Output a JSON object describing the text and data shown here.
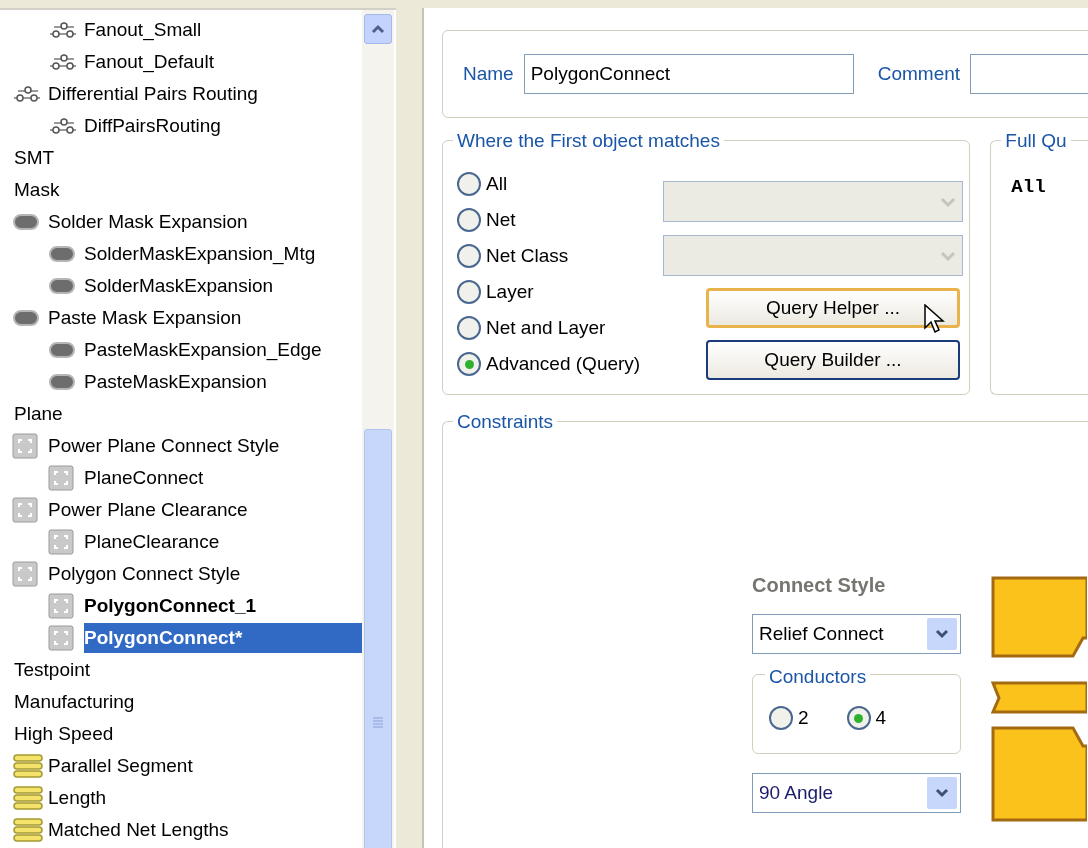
{
  "tree": [
    {
      "children": [
        {
          "children": [
            {
              "label": "Fanout_Small",
              "kind": "routing",
              "bold": false,
              "selected": false
            },
            {
              "label": "Fanout_Default",
              "kind": "routing",
              "bold": false,
              "selected": false
            }
          ]
        },
        {
          "label": "Differential Pairs Routing",
          "kind": "routing",
          "bold": false,
          "selected": false,
          "children": [
            {
              "label": "DiffPairsRouting",
              "kind": "routing",
              "bold": false,
              "selected": false
            }
          ]
        }
      ]
    },
    {
      "label": "SMT",
      "bold": false,
      "selected": false
    },
    {
      "label": "Mask",
      "bold": false,
      "selected": false,
      "children": [
        {
          "label": "Solder Mask Expansion",
          "kind": "mask",
          "bold": false,
          "selected": false,
          "children": [
            {
              "label": "SolderMaskExpansion_Mtg",
              "kind": "mask",
              "bold": false,
              "selected": false
            },
            {
              "label": "SolderMaskExpansion",
              "kind": "mask",
              "bold": false,
              "selected": false
            }
          ]
        },
        {
          "label": "Paste Mask Expansion",
          "kind": "mask",
          "bold": false,
          "selected": false,
          "children": [
            {
              "label": "PasteMaskExpansion_Edge",
              "kind": "mask",
              "bold": false,
              "selected": false
            },
            {
              "label": "PasteMaskExpansion",
              "kind": "mask",
              "bold": false,
              "selected": false
            }
          ]
        }
      ]
    },
    {
      "label": "Plane",
      "bold": false,
      "selected": false,
      "children": [
        {
          "label": "Power Plane Connect Style",
          "kind": "plane",
          "bold": false,
          "selected": false,
          "children": [
            {
              "label": "PlaneConnect",
              "kind": "plane",
              "bold": false,
              "selected": false
            }
          ]
        },
        {
          "label": "Power Plane Clearance",
          "kind": "plane",
          "bold": false,
          "selected": false,
          "children": [
            {
              "label": "PlaneClearance",
              "kind": "plane",
              "bold": false,
              "selected": false
            }
          ]
        },
        {
          "label": "Polygon Connect Style",
          "kind": "plane",
          "bold": false,
          "selected": false,
          "children": [
            {
              "label": "PolygonConnect_1",
              "kind": "plane",
              "bold": true,
              "selected": false
            },
            {
              "label": "PolygonConnect*",
              "kind": "plane",
              "bold": true,
              "selected": true
            }
          ]
        }
      ]
    },
    {
      "label": "Testpoint",
      "bold": false,
      "selected": false
    },
    {
      "label": "Manufacturing",
      "bold": false,
      "selected": false
    },
    {
      "label": "High Speed",
      "bold": false,
      "selected": false,
      "children": [
        {
          "label": "Parallel Segment",
          "kind": "highspeed",
          "bold": false,
          "selected": false
        },
        {
          "label": "Length",
          "kind": "highspeed",
          "bold": false,
          "selected": false
        },
        {
          "label": "Matched Net Lengths",
          "kind": "highspeed",
          "bold": false,
          "selected": false
        }
      ]
    }
  ],
  "rule": {
    "name_label": "Name",
    "name_value": "PolygonConnect",
    "comment_label": "Comment"
  },
  "scope": {
    "title": "Where the First object matches",
    "options": [
      {
        "label": "All",
        "selected": false
      },
      {
        "label": "Net",
        "selected": false
      },
      {
        "label": "Net Class",
        "selected": false
      },
      {
        "label": "Layer",
        "selected": false
      },
      {
        "label": "Net and Layer",
        "selected": false
      },
      {
        "label": "Advanced (Query)",
        "selected": true
      }
    ],
    "buttons": [
      {
        "label": "Query Helper ...",
        "hovered": true
      },
      {
        "label": "Query Builder ...",
        "hovered": false
      }
    ]
  },
  "full_query": {
    "title": "Full Qu",
    "text": "All"
  },
  "constraints": {
    "title": "Constraints",
    "connect_style_label": "Connect Style",
    "connect_style": "Relief Connect",
    "conductors": {
      "title": "Conductors",
      "options": [
        {
          "label": "2",
          "selected": false
        },
        {
          "label": "4",
          "selected": true
        }
      ]
    },
    "angle": "90 Angle"
  }
}
